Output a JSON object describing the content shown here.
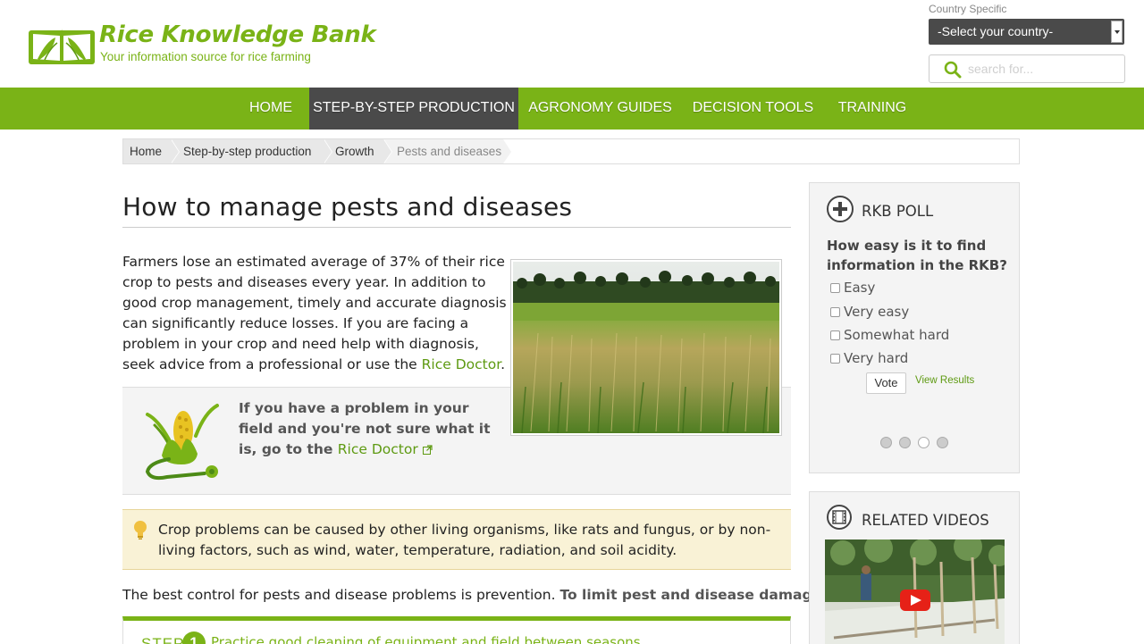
{
  "site": {
    "title": "Rice Knowledge Bank",
    "tagline": "Your information source for rice farming",
    "brand_color": "#7ab317"
  },
  "country": {
    "label": "Country Specific",
    "selected": "-Select your country-"
  },
  "search": {
    "placeholder": "search for...",
    "icon": "search-icon"
  },
  "nav": {
    "items": [
      {
        "label": "HOME",
        "active": false
      },
      {
        "label": "STEP-BY-STEP PRODUCTION",
        "active": true
      },
      {
        "label": "AGRONOMY GUIDES",
        "active": false
      },
      {
        "label": "DECISION TOOLS",
        "active": false
      },
      {
        "label": "TRAINING",
        "active": false
      }
    ]
  },
  "breadcrumb": {
    "items": [
      "Home",
      "Step-by-step production",
      "Growth",
      "Pests and diseases"
    ]
  },
  "main": {
    "title": "How to manage pests and diseases",
    "intro_text": "Farmers lose an estimated average of 37% of their rice crop to pests and diseases every year. In addition to good crop management, timely and accurate diagnosis can significantly reduce losses. If you are facing a problem in your crop and need help with diagnosis, seek advice from a professional or use the ",
    "intro_link": "Rice Doctor",
    "intro_end": ".",
    "doctor": {
      "text": "If you have a problem in your field and you're not sure what it is, go to the ",
      "link": "Rice Doctor",
      "external_icon": "external-link-icon"
    },
    "tip": {
      "icon": "lightbulb-icon",
      "text": "Crop problems can be caused by other living organisms, like rats and fungus, or by non-living factors, such as wind, water, temperature, radiation, and soil acidity."
    },
    "prevention_text": "The best control for pests and disease problems is prevention. ",
    "prevention_bold": "To limit pest and disease damage:",
    "step": {
      "label": "STEP",
      "number": "1",
      "text": "Practice good cleaning of equipment and field between seasons"
    }
  },
  "poll": {
    "heading": "RKB POLL",
    "icon": "plus-circle-icon",
    "question": "How easy is it to find information in the RKB?",
    "options": [
      "Easy",
      "Very easy",
      "Somewhat hard",
      "Very hard"
    ],
    "vote_label": "Vote",
    "results_label": "View Results"
  },
  "videos": {
    "heading": "RELATED VIDEOS",
    "icon": "film-icon",
    "play_icon": "youtube-play-icon"
  }
}
